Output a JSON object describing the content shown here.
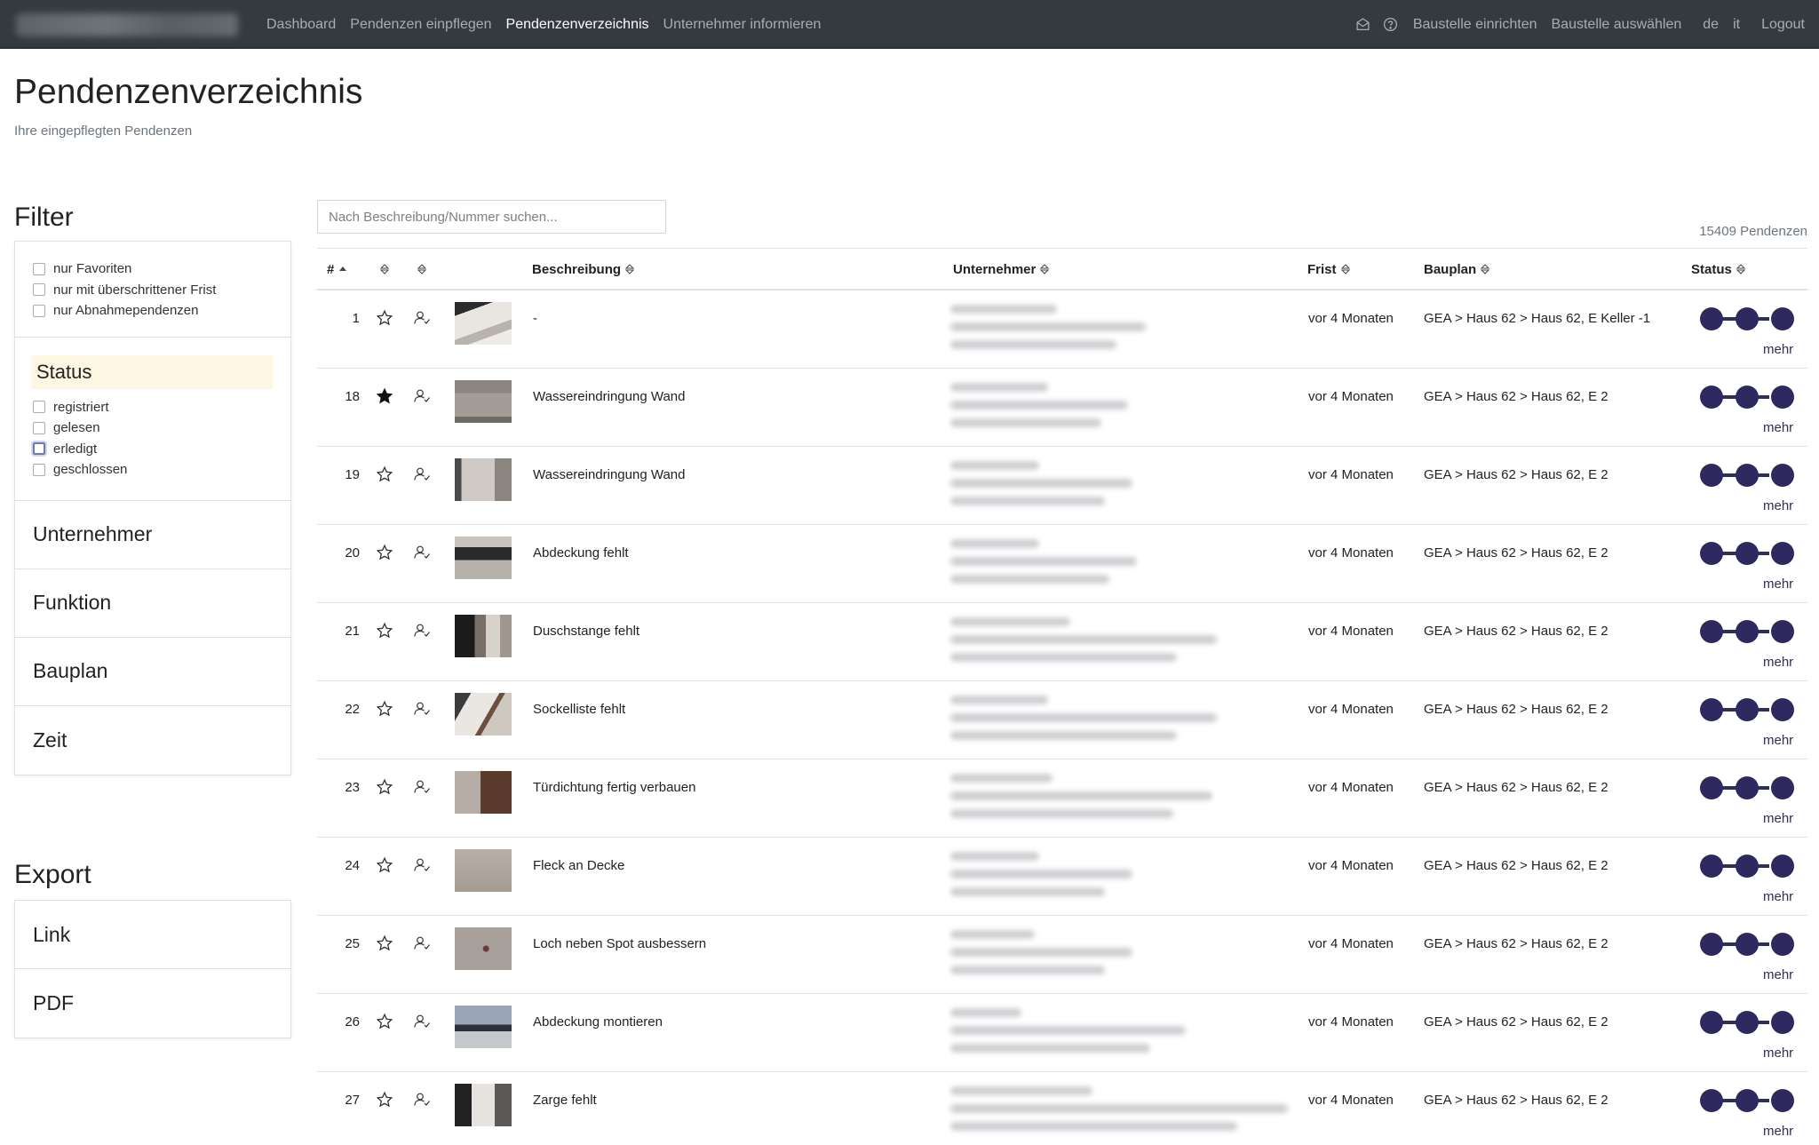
{
  "nav": {
    "left": [
      "Dashboard",
      "Pendenzen einpflegen",
      "Pendenzenverzeichnis",
      "Unternehmer informieren"
    ],
    "right": [
      "Baustelle einrichten",
      "Baustelle auswählen",
      "de",
      "it",
      "Logout"
    ]
  },
  "header": {
    "title": "Pendenzenverzeichnis",
    "subtitle": "Ihre eingepflegten Pendenzen"
  },
  "filter": {
    "heading": "Filter",
    "options": [
      "nur Favoriten",
      "nur mit überschrittener Frist",
      "nur Abnahmependenzen"
    ],
    "status_heading": "Status",
    "status_options": [
      "registriert",
      "gelesen",
      "erledigt",
      "geschlossen"
    ],
    "sections": [
      "Unternehmer",
      "Funktion",
      "Bauplan",
      "Zeit"
    ]
  },
  "export": {
    "heading": "Export",
    "items": [
      "Link",
      "PDF"
    ]
  },
  "search": {
    "placeholder": "Nach Beschreibung/Nummer suchen..."
  },
  "count": "15409 Pendenzen",
  "table": {
    "headers": {
      "num": "#",
      "beschreibung": "Beschreibung",
      "unternehmer": "Unternehmer",
      "frist": "Frist",
      "bauplan": "Bauplan",
      "status": "Status"
    },
    "rows": [
      {
        "num": "1",
        "favorite": false,
        "beschreibung": "-",
        "frist": "vor 4 Monaten",
        "bauplan": "GEA > Haus 62 > Haus 62, E Keller -1",
        "mehr": "mehr"
      },
      {
        "num": "18",
        "favorite": true,
        "beschreibung": "Wassereindringung Wand",
        "frist": "vor 4 Monaten",
        "bauplan": "GEA > Haus 62 > Haus 62, E 2",
        "mehr": "mehr"
      },
      {
        "num": "19",
        "favorite": false,
        "beschreibung": "Wassereindringung Wand",
        "frist": "vor 4 Monaten",
        "bauplan": "GEA > Haus 62 > Haus 62, E 2",
        "mehr": "mehr"
      },
      {
        "num": "20",
        "favorite": false,
        "beschreibung": "Abdeckung fehlt",
        "frist": "vor 4 Monaten",
        "bauplan": "GEA > Haus 62 > Haus 62, E 2",
        "mehr": "mehr"
      },
      {
        "num": "21",
        "favorite": false,
        "beschreibung": "Duschstange fehlt",
        "frist": "vor 4 Monaten",
        "bauplan": "GEA > Haus 62 > Haus 62, E 2",
        "mehr": "mehr"
      },
      {
        "num": "22",
        "favorite": false,
        "beschreibung": "Sockelliste fehlt",
        "frist": "vor 4 Monaten",
        "bauplan": "GEA > Haus 62 > Haus 62, E 2",
        "mehr": "mehr"
      },
      {
        "num": "23",
        "favorite": false,
        "beschreibung": "Türdichtung fertig verbauen",
        "frist": "vor 4 Monaten",
        "bauplan": "GEA > Haus 62 > Haus 62, E 2",
        "mehr": "mehr"
      },
      {
        "num": "24",
        "favorite": false,
        "beschreibung": "Fleck an Decke",
        "frist": "vor 4 Monaten",
        "bauplan": "GEA > Haus 62 > Haus 62, E 2",
        "mehr": "mehr"
      },
      {
        "num": "25",
        "favorite": false,
        "beschreibung": "Loch neben Spot ausbessern",
        "frist": "vor 4 Monaten",
        "bauplan": "GEA > Haus 62 > Haus 62, E 2",
        "mehr": "mehr"
      },
      {
        "num": "26",
        "favorite": false,
        "beschreibung": "Abdeckung montieren",
        "frist": "vor 4 Monaten",
        "bauplan": "GEA > Haus 62 > Haus 62, E 2",
        "mehr": "mehr"
      },
      {
        "num": "27",
        "favorite": false,
        "beschreibung": "Zarge fehlt",
        "frist": "vor 4 Monaten",
        "bauplan": "GEA > Haus 62 > Haus 62, E 2",
        "mehr": "mehr"
      }
    ]
  },
  "colors": {
    "navbar": "#343a40",
    "status_dot": "#2e2a5f",
    "status_highlight": "#fdf6e3"
  }
}
